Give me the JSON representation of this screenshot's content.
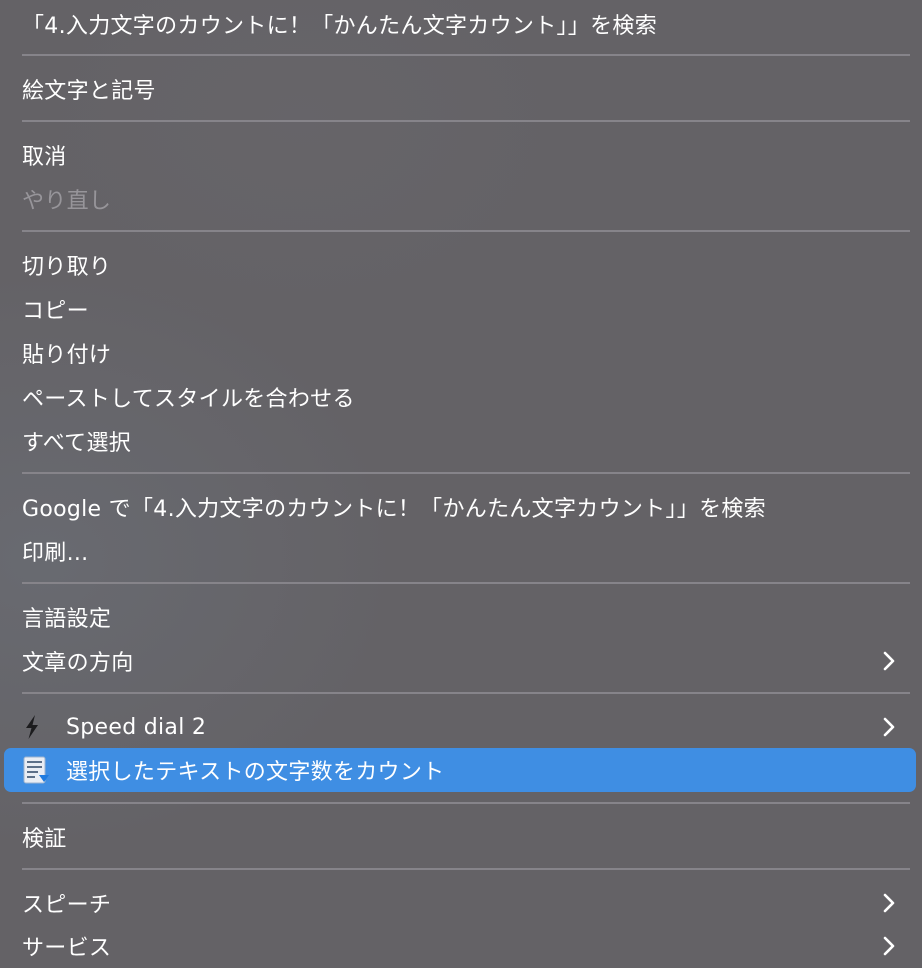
{
  "menu": {
    "search_selection": "「4.入力文字のカウントに！「かんたん文字カウント」」を検索",
    "emoji": "絵文字と記号",
    "undo": "取消",
    "redo": "やり直し",
    "cut": "切り取り",
    "copy": "コピー",
    "paste": "貼り付け",
    "paste_match_style": "ペーストしてスタイルを合わせる",
    "select_all": "すべて選択",
    "google_search": "Google で「4.入力文字のカウントに！「かんたん文字カウント」」を検索",
    "print": "印刷...",
    "language_settings": "言語設定",
    "writing_direction": "文章の方向",
    "speed_dial": "Speed dial 2",
    "count_characters": "選択したテキストの文字数をカウント",
    "inspect": "検証",
    "speech": "スピーチ",
    "services": "サービス"
  },
  "colors": {
    "menu_background": "#646266",
    "selected_highlight": "#3f8ee3",
    "disabled_text": "#97959a",
    "separator": "#86848a"
  },
  "icons": {
    "submenu": "chevron-right-icon",
    "speed_dial": "lightning-bolt-icon",
    "count_characters": "document-count-icon"
  }
}
